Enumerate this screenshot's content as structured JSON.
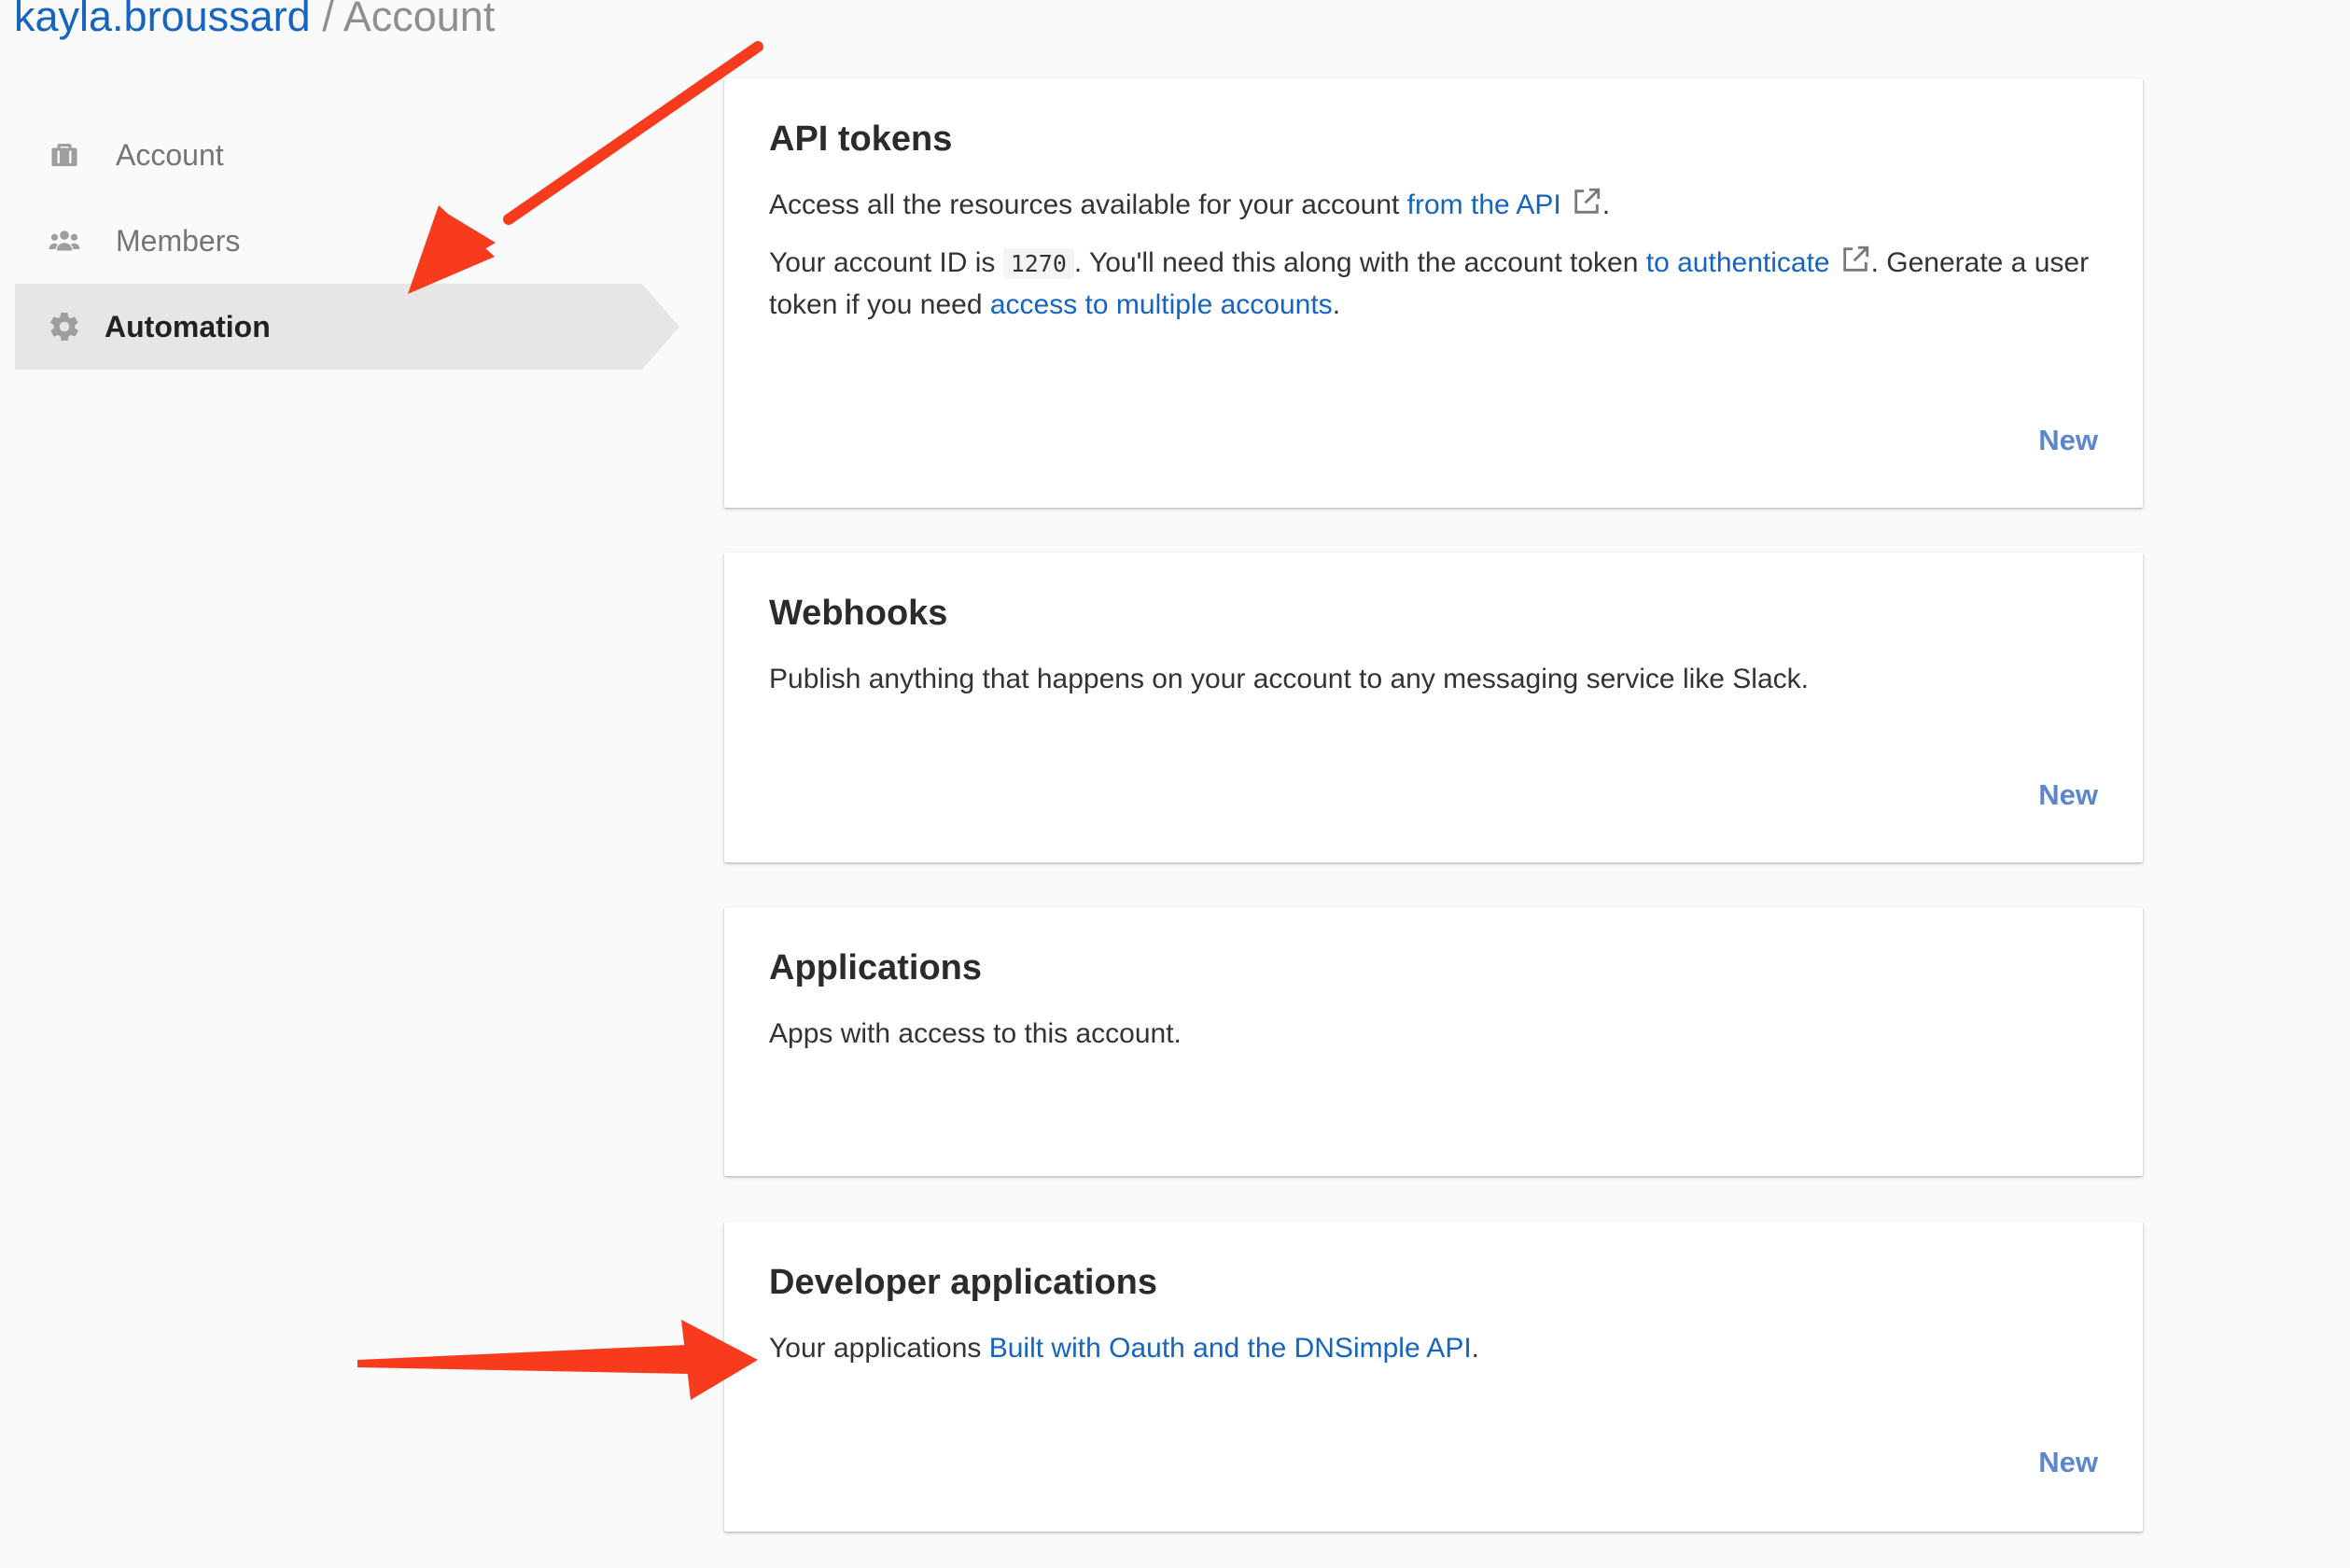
{
  "breadcrumb": {
    "user": "kayla.broussard",
    "separator": "/",
    "current": "Account"
  },
  "sidebar": {
    "items": [
      {
        "label": "Account",
        "icon": "briefcase-icon"
      },
      {
        "label": "Members",
        "icon": "users-icon"
      },
      {
        "label": "Automation",
        "icon": "gear-icon",
        "active": true
      }
    ]
  },
  "cards": {
    "api_tokens": {
      "title": "API tokens",
      "line1_prefix": "Access all the resources available for your account ",
      "line1_link": "from the API",
      "line1_suffix": ".",
      "line2_prefix": "Your account ID is ",
      "account_id": "1270",
      "line2_middle": ". You'll need this along with the account token ",
      "line2_link": "to authenticate",
      "line2_after_link": ". Generate a user token if you need ",
      "line2_link2": "access to multiple accounts",
      "line2_suffix": ".",
      "new_label": "New"
    },
    "webhooks": {
      "title": "Webhooks",
      "description": "Publish anything that happens on your account to any messaging service like Slack.",
      "new_label": "New"
    },
    "applications": {
      "title": "Applications",
      "description": "Apps with access to this account."
    },
    "developer_applications": {
      "title": "Developer applications",
      "desc_prefix": "Your applications ",
      "desc_link": "Built with Oauth and the DNSimple API",
      "desc_suffix": ".",
      "new_label": "New"
    }
  },
  "colors": {
    "link": "#1565c0",
    "new_button": "#5c86d0",
    "annotation_arrow": "#f73b1c"
  }
}
